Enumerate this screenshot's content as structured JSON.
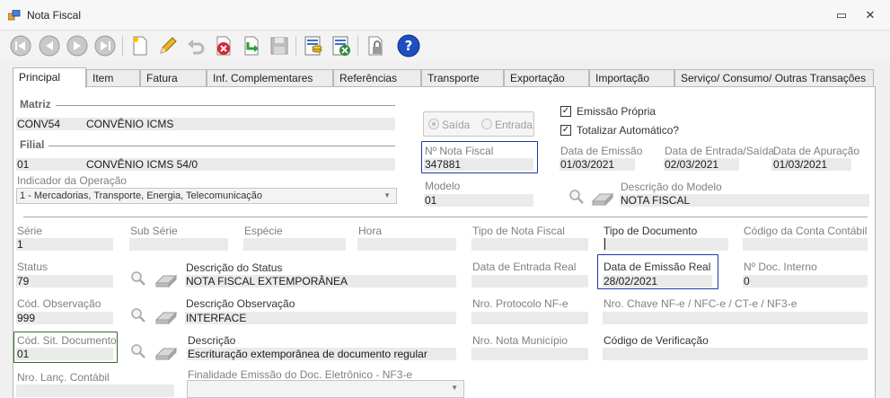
{
  "window": {
    "title": "Nota Fiscal",
    "minimize_glyph": "▭",
    "close_glyph": "✕"
  },
  "tabs": [
    {
      "label": "Principal"
    },
    {
      "label": "Item"
    },
    {
      "label": "Fatura"
    },
    {
      "label": "Inf. Complementares"
    },
    {
      "label": "Referências"
    },
    {
      "label": "Transporte"
    },
    {
      "label": "Exportação"
    },
    {
      "label": "Importação"
    },
    {
      "label": "Serviço/ Consumo/ Outras Transações"
    }
  ],
  "matriz": {
    "section": "Matriz",
    "code": "CONV54",
    "name": "CONVÊNIO ICMS"
  },
  "filial": {
    "section": "Filial",
    "code": "01",
    "name": "CONVÊNIO ICMS 54/0"
  },
  "indicador": {
    "label": "Indicador da Operação",
    "value": "1 - Mercadorias, Transporte, Energia, Telecomunicação"
  },
  "movimento": {
    "saida": "Saída",
    "entrada": "Entrada"
  },
  "checks": {
    "emissao_propria": "Emissão Própria",
    "totalizar": "Totalizar Automático?",
    "mark": "✓"
  },
  "nota": {
    "label": "Nº Nota Fiscal",
    "value": "347881"
  },
  "datas": {
    "emissao_label": "Data de Emissão",
    "emissao_value": "01/03/2021",
    "entrada_saida_label": "Data de Entrada/Saída",
    "entrada_saida_value": "02/03/2021",
    "apuracao_label": "Data de Apuração",
    "apuracao_value": "01/03/2021"
  },
  "modelo": {
    "label": "Modelo",
    "value": "01",
    "desc_label": "Descrição do Modelo",
    "desc_value": "NOTA FISCAL"
  },
  "row1": {
    "serie_label": "Série",
    "serie_value": "1",
    "subserie_label": "Sub Série",
    "especie_label": "Espécie",
    "hora_label": "Hora",
    "tipo_nf_label": "Tipo de Nota Fiscal",
    "tipo_doc_label": "Tipo de Documento",
    "conta_label": "Código da Conta Contábil"
  },
  "row2": {
    "status_label": "Status",
    "status_value": "79",
    "desc_status_label": "Descrição do Status",
    "desc_status_value": "NOTA FISCAL EXTEMPORÂNEA",
    "entrada_real_label": "Data de Entrada Real",
    "emissao_real_label": "Data de Emissão Real",
    "emissao_real_value": "28/02/2021",
    "doc_interno_label": "Nº Doc. Interno",
    "doc_interno_value": "0"
  },
  "row3": {
    "obs_label": "Cód. Observação",
    "obs_value": "999",
    "desc_obs_label": "Descrição Observação",
    "desc_obs_value": "INTERFACE",
    "protocolo_label": "Nro. Protocolo NF-e",
    "chave_label": "Nro. Chave NF-e / NFC-e / CT-e / NF3-e"
  },
  "row4": {
    "sit_label": "Cód. Sit. Documento",
    "sit_value": "01",
    "desc_label": "Descrição",
    "desc_value": "Escrituração extemporânea de documento regular",
    "municipio_label": "Nro. Nota Município",
    "verificacao_label": "Código de Verificação"
  },
  "row5": {
    "lanc_label": "Nro. Lanç. Contábil",
    "finalidade_label": "Finalidade Emissão do Doc. Eletrônico - NF3-e"
  }
}
